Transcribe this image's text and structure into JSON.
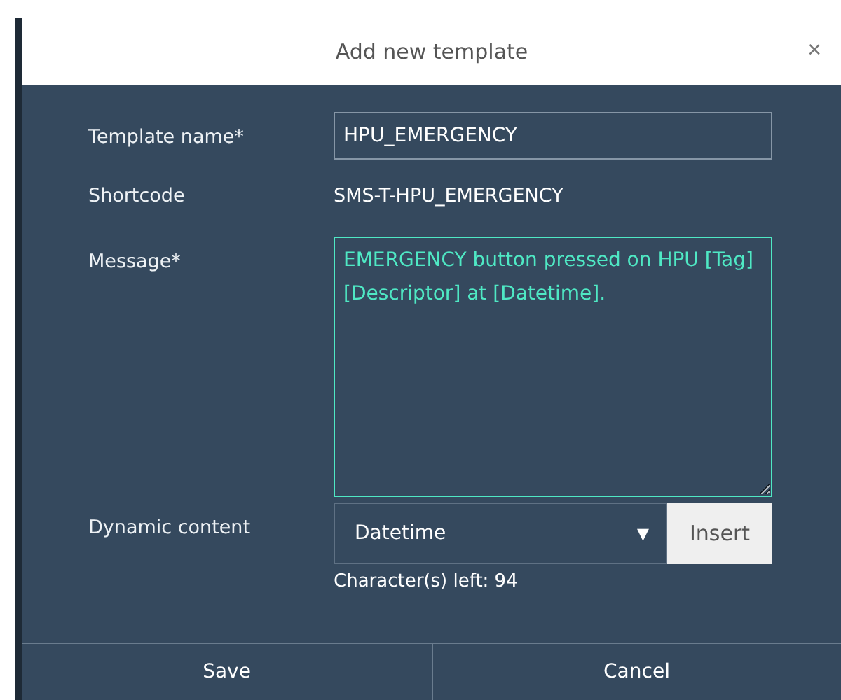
{
  "dialog": {
    "title": "Add new template",
    "close": "×"
  },
  "fields": [
    {
      "kind": "input",
      "label": "Template name*",
      "value": "HPU_EMERGENCY"
    },
    {
      "kind": "text",
      "label": "Shortcode",
      "value": "SMS-T-HPU_EMERGENCY"
    },
    {
      "kind": "textarea",
      "label": "Message*",
      "value": "EMERGENCY button pressed on HPU [Tag] [Descriptor] at [Datetime]."
    },
    {
      "kind": "select",
      "label": "Dynamic content",
      "value": "Datetime",
      "arrow": "▼",
      "button": "Insert",
      "hint": "Character(s) left: 94"
    }
  ],
  "buttons": [
    "Save",
    "Cancel"
  ]
}
